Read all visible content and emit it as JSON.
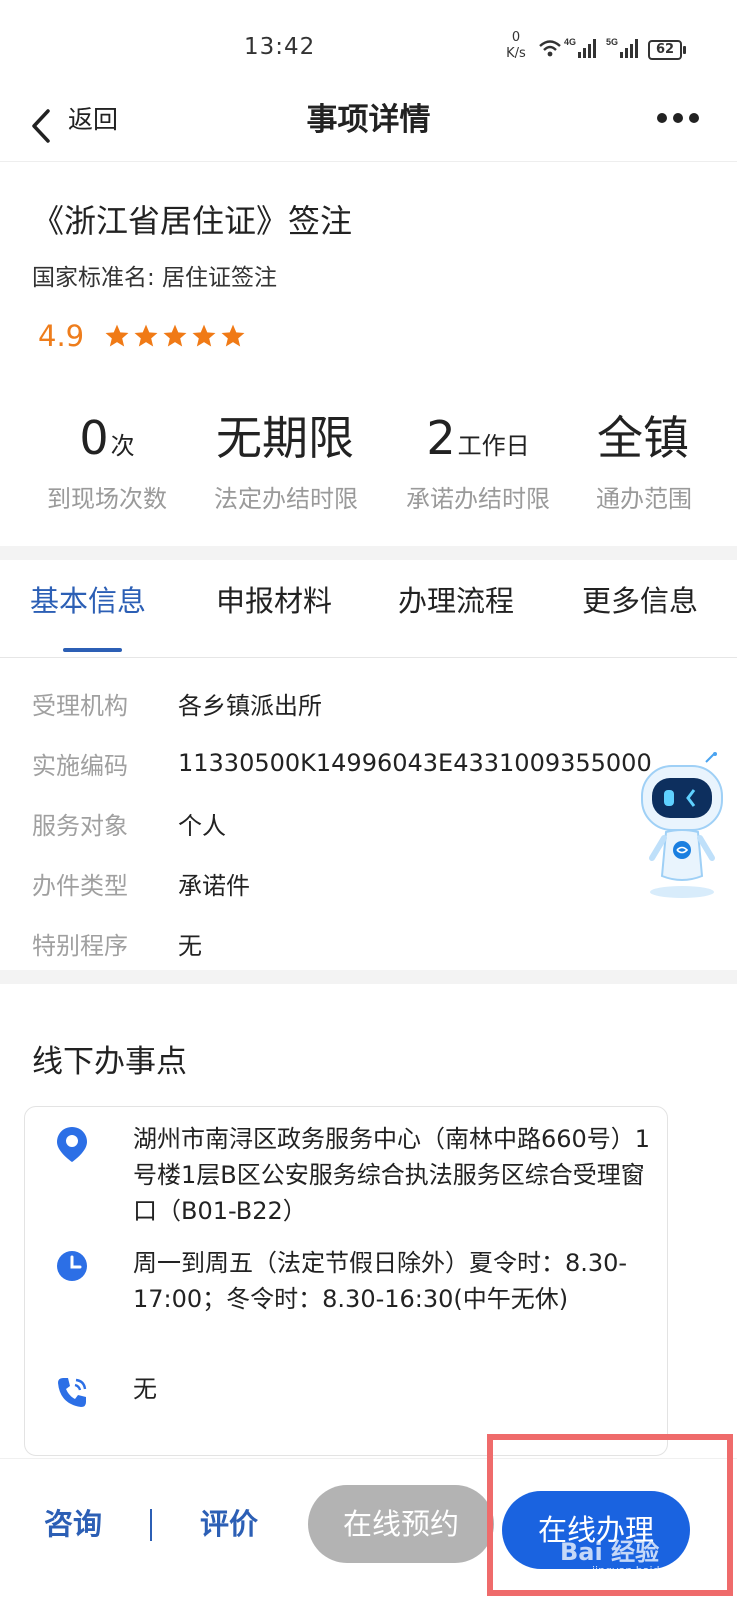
{
  "status_bar": {
    "time": "13:42",
    "net_speed_value": "0",
    "net_speed_unit": "K/s",
    "sig1_tag": "4G",
    "sig2_tag": "5G",
    "battery": "62"
  },
  "nav": {
    "back_label": "返回",
    "title": "事项详情"
  },
  "item": {
    "title": "《浙江省居住证》签注",
    "standard_name": "国家标准名: 居住证签注",
    "rating": "4.9",
    "stars": 5,
    "star_color": "#f07a16"
  },
  "stats": [
    {
      "value": "0",
      "unit": "次",
      "label": "到现场次数"
    },
    {
      "value": "无期限",
      "unit": "",
      "label": "法定办结时限"
    },
    {
      "value": "2",
      "unit": "工作日",
      "label": "承诺办结时限"
    },
    {
      "value": "全镇",
      "unit": "",
      "label": "通办范围"
    }
  ],
  "tabs": [
    {
      "label": "基本信息",
      "active": true
    },
    {
      "label": "申报材料",
      "active": false
    },
    {
      "label": "办理流程",
      "active": false
    },
    {
      "label": "更多信息",
      "active": false
    }
  ],
  "info": [
    {
      "label": "受理机构",
      "value": "各乡镇派出所"
    },
    {
      "label": "实施编码",
      "value": "11330500K14996043E4331009355000"
    },
    {
      "label": "服务对象",
      "value": "个人"
    },
    {
      "label": "办件类型",
      "value": "承诺件"
    },
    {
      "label": "特别程序",
      "value": "无"
    }
  ],
  "offline": {
    "title": "线下办事点",
    "address": "湖州市南浔区政务服务中心（南林中路660号）1号楼1层B区公安服务综合执法服务区综合受理窗口（B01-B22）",
    "hours": "周一到周五（法定节假日除外）夏令时：8.30-17:00；冬令时：8.30-16:30(中午无休)",
    "phone": "无"
  },
  "bottom": {
    "consult_label": "咨询",
    "rate_label": "评价",
    "reserve_label": "在线预约",
    "handle_label": "在线办理"
  },
  "watermark": {
    "text": "Bai 经验",
    "sub": "jingyan.baidu.com"
  },
  "colors": {
    "accent": "#2c5fb5",
    "primary_button": "#1a63e0",
    "disabled_button": "#b3b3b3",
    "rating": "#ee7d1c",
    "highlight": "#ef6b6b"
  }
}
